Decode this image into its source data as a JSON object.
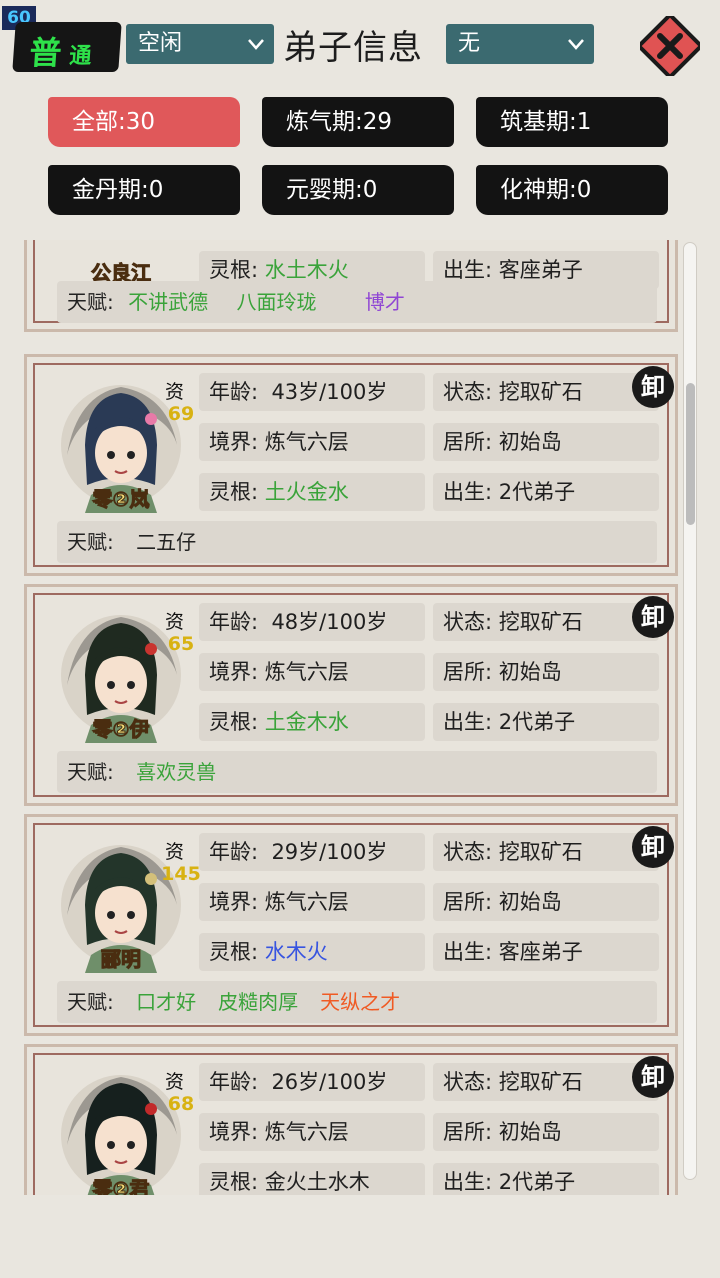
{
  "fps": "60",
  "mode_badge": [
    "普",
    "通"
  ],
  "filters": {
    "status_value": "空闲",
    "realm_value": "无"
  },
  "title": "弟子信息",
  "tabs": [
    {
      "label": "全部:30",
      "active": true
    },
    {
      "label": "炼气期:29",
      "active": false
    },
    {
      "label": "筑基期:1",
      "active": false
    },
    {
      "label": "金丹期:0",
      "active": false
    },
    {
      "label": "元婴期:0",
      "active": false
    },
    {
      "label": "化神期:0",
      "active": false
    }
  ],
  "labels": {
    "age": "年龄:",
    "realm": "境界:",
    "root": "灵根:",
    "status": "状态:",
    "residence": "居所:",
    "birth": "出生:",
    "talent": "天赋:",
    "aptitude": "资"
  },
  "partial_card": {
    "name": "公良江",
    "root": "水土木火",
    "root_color": "#3aa33a",
    "birth": "客座弟子",
    "talents": [
      {
        "text": "不讲武德",
        "color": "#3aa33a"
      },
      {
        "text": "八面玲珑",
        "color": "#3aa33a"
      },
      {
        "text": "博才",
        "color": "#9046d4"
      }
    ]
  },
  "disciples": [
    {
      "name": "零②岚",
      "aptitude": "69",
      "age": "43岁/100岁",
      "realm": "炼气六层",
      "root": "土火金水",
      "root_color": "#3aa33a",
      "status": "挖取矿石",
      "residence": "初始岛",
      "birth": "2代弟子",
      "talents": [
        {
          "text": "二五仔",
          "color": "#222222"
        }
      ],
      "hair": "#2a3a55",
      "accent": "#e87aa8"
    },
    {
      "name": "零②伊",
      "aptitude": "65",
      "age": "48岁/100岁",
      "realm": "炼气六层",
      "root": "土金木水",
      "root_color": "#3aa33a",
      "status": "挖取矿石",
      "residence": "初始岛",
      "birth": "2代弟子",
      "talents": [
        {
          "text": "喜欢灵兽",
          "color": "#3aa33a"
        }
      ],
      "hair": "#1f2a20",
      "accent": "#c9342f"
    },
    {
      "name": "郦明",
      "aptitude": "145",
      "age": "29岁/100岁",
      "realm": "炼气六层",
      "root": "水木火",
      "root_color": "#3754e0",
      "status": "挖取矿石",
      "residence": "初始岛",
      "birth": "客座弟子",
      "talents": [
        {
          "text": "口才好",
          "color": "#3aa33a"
        },
        {
          "text": "皮糙肉厚",
          "color": "#3aa33a"
        },
        {
          "text": "天纵之才",
          "color": "#f05a23"
        }
      ],
      "hair": "#23352a",
      "accent": "#d4c07a"
    },
    {
      "name": "零②君",
      "aptitude": "68",
      "age": "26岁/100岁",
      "realm": "炼气六层",
      "root": "金火土水木",
      "root_color": "#222222",
      "status": "挖取矿石",
      "residence": "初始岛",
      "birth": "2代弟子",
      "talents": [],
      "hair": "#16201e",
      "accent": "#c22a2a"
    }
  ],
  "seal_char": "卸"
}
